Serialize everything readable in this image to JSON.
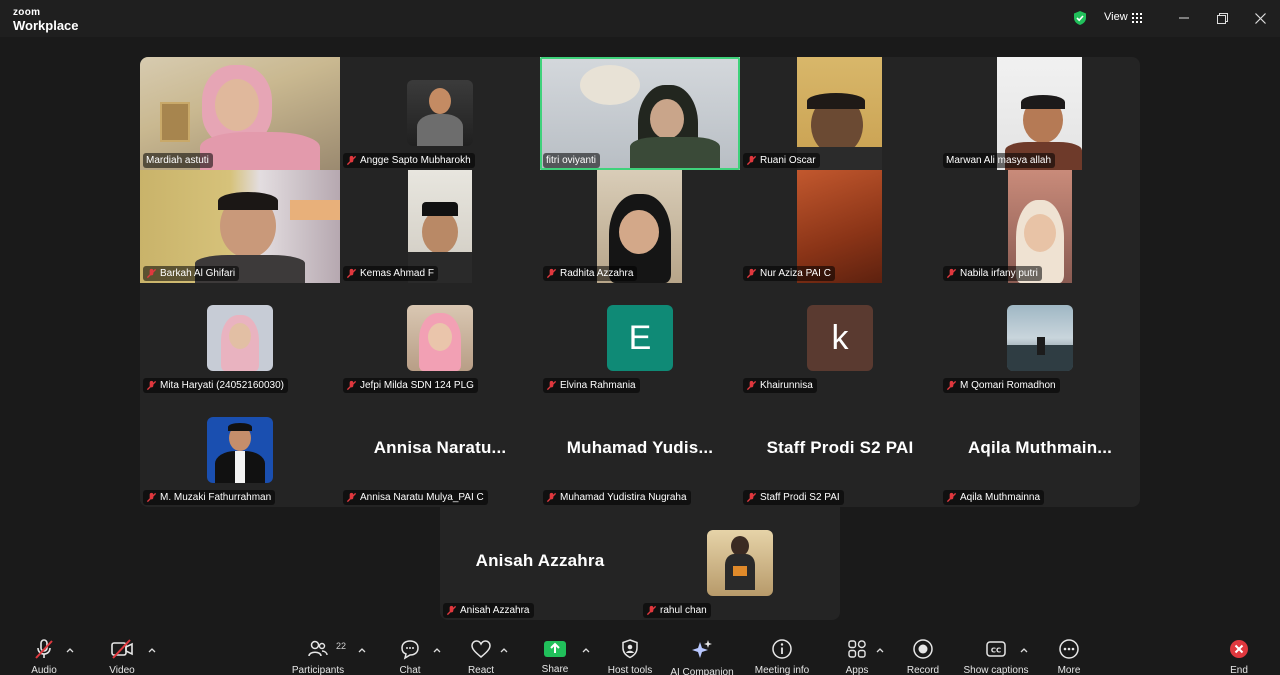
{
  "app": {
    "brand_top": "zoom",
    "brand_bottom": "Workplace"
  },
  "header": {
    "view_label": "View"
  },
  "colors": {
    "active_speaker": "#3fd27b",
    "muted": "#e0383e",
    "share": "#21c05b",
    "tile_bg": "#242424"
  },
  "participants": [
    {
      "name": "Mardiah astuti",
      "muted": false,
      "type": "video"
    },
    {
      "name": "Angge Sapto Mubharokh",
      "muted": true,
      "type": "photo"
    },
    {
      "name": "fitri oviyanti",
      "muted": false,
      "type": "video",
      "active": true
    },
    {
      "name": "Ruani Oscar",
      "muted": true,
      "type": "video"
    },
    {
      "name": "Marwan Ali masya allah",
      "muted": false,
      "type": "video"
    },
    {
      "name": "Barkah Al Ghifari",
      "muted": true,
      "type": "video"
    },
    {
      "name": "Kemas Ahmad F",
      "muted": true,
      "type": "video"
    },
    {
      "name": "Radhita Azzahra",
      "muted": true,
      "type": "video"
    },
    {
      "name": "Nur Aziza PAI C",
      "muted": true,
      "type": "video"
    },
    {
      "name": "Nabila irfany putri",
      "muted": true,
      "type": "video"
    },
    {
      "name": "Mita Haryati (24052160030)",
      "muted": true,
      "type": "photo"
    },
    {
      "name": "Jefpi Milda SDN 124 PLG",
      "muted": true,
      "type": "photo"
    },
    {
      "name": "Elvina Rahmania",
      "muted": true,
      "type": "letter",
      "letter": "E",
      "color": "#0f8a76"
    },
    {
      "name": "Khairunnisa",
      "muted": true,
      "type": "letter",
      "letter": "k",
      "color": "#5a3a30"
    },
    {
      "name": "M Qomari Romadhon",
      "muted": true,
      "type": "photo"
    },
    {
      "name": "M. Muzaki Fathurrahman",
      "muted": true,
      "type": "photo"
    },
    {
      "name": "Annisa Naratu Mulya_PAI C",
      "muted": true,
      "type": "text",
      "display": "Annisa  Naratu..."
    },
    {
      "name": "Muhamad Yudistira Nugraha",
      "muted": true,
      "type": "text",
      "display": "Muhamad  Yudis..."
    },
    {
      "name": "Staff Prodi S2 PAI",
      "muted": true,
      "type": "text",
      "display": "Staff Prodi S2 PAI"
    },
    {
      "name": "Aqila Muthmainna",
      "muted": true,
      "type": "text",
      "display": "Aqila  Muthmain..."
    },
    {
      "name": "Anisah Azzahra",
      "muted": true,
      "type": "text",
      "display": "Anisah Azzahra"
    },
    {
      "name": "rahul chan",
      "muted": true,
      "type": "photo"
    }
  ],
  "toolbar": {
    "audio": "Audio",
    "video": "Video",
    "participants": "Participants",
    "participants_count": "22",
    "chat": "Chat",
    "react": "React",
    "share": "Share",
    "host_tools": "Host tools",
    "ai_companion": "AI Companion",
    "meeting_info": "Meeting info",
    "apps": "Apps",
    "record": "Record",
    "show_captions": "Show captions",
    "more": "More",
    "end": "End"
  }
}
